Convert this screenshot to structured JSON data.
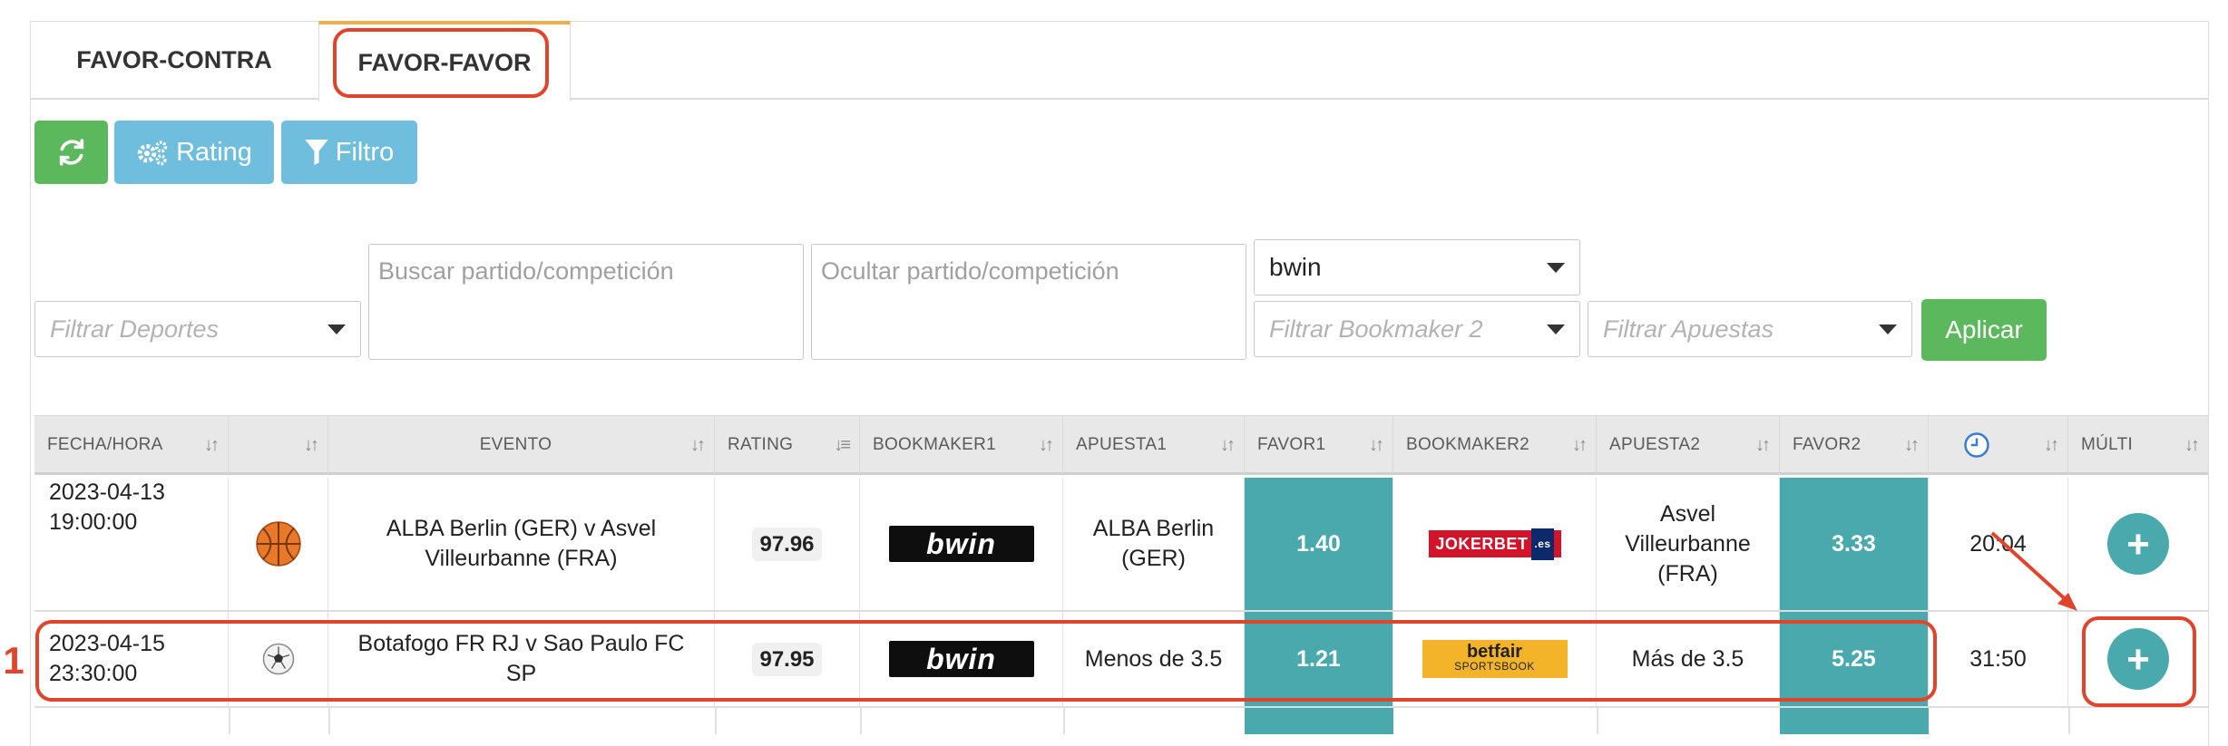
{
  "tabs": [
    {
      "label": "FAVOR-CONTRA",
      "active": false
    },
    {
      "label": "FAVOR-FAVOR",
      "active": true
    }
  ],
  "toolbar": {
    "refresh_icon": "refresh-icon",
    "rating_label": "Rating",
    "rating_icon": "gears-icon",
    "filter_label": "Filtro",
    "filter_icon": "filter-icon"
  },
  "filters": {
    "sports_placeholder": "Filtrar Deportes",
    "search_placeholder": "Buscar partido/competición",
    "hide_placeholder": "Ocultar partido/competición",
    "bookmaker1_value": "bwin",
    "bookmaker2_placeholder": "Filtrar Bookmaker 2",
    "bets_placeholder": "Filtrar Apuestas",
    "apply_label": "Aplicar"
  },
  "table": {
    "columns": [
      "FECHA/HORA",
      "",
      "EVENTO",
      "RATING",
      "BOOKMAKER1",
      "APUESTA1",
      "FAVOR1",
      "BOOKMAKER2",
      "APUESTA2",
      "FAVOR2",
      "clock-icon",
      "MÚLTI"
    ],
    "rows": [
      {
        "date": "2023-04-13",
        "time": "19:00:00",
        "sport_icon": "basketball-icon",
        "event": "ALBA Berlin (GER) v Asvel Villeurbanne (FRA)",
        "rating": "97.96",
        "bookmaker1": "bwin",
        "bet1": "ALBA Berlin (GER)",
        "favor1": "1.40",
        "bookmaker2": "JOKERBET",
        "bookmaker2_suffix": ".es",
        "bet2": "Asvel Villeurbanne (FRA)",
        "favor2": "3.33",
        "remaining": "20:04"
      },
      {
        "date": "2023-04-15",
        "time": "23:30:00",
        "sport_icon": "soccer-ball-icon",
        "event": "Botafogo FR RJ v Sao Paulo FC SP",
        "rating": "97.95",
        "bookmaker1": "bwin",
        "bet1": "Menos de 3.5",
        "favor1": "1.21",
        "bookmaker2": "betfair",
        "bookmaker2_sub": "SPORTSBOOK",
        "bet2": "Más de 3.5",
        "favor2": "5.25",
        "remaining": "31:50"
      }
    ]
  },
  "annotation": {
    "step_number": "1",
    "color": "#e0452c"
  }
}
